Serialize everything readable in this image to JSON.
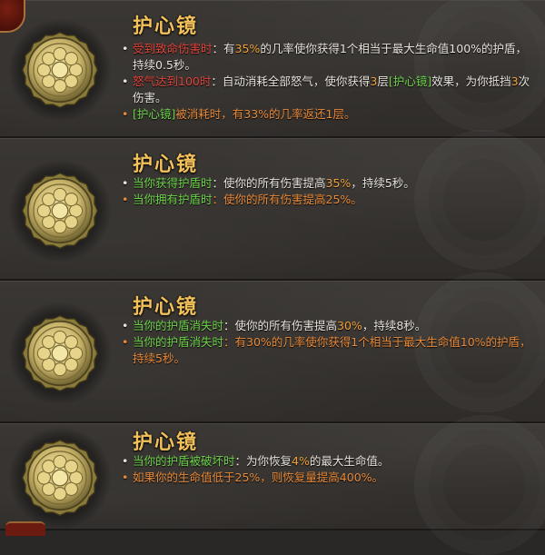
{
  "items": [
    {
      "title": "护心镜",
      "lines": [
        {
          "bullet_color": "w",
          "segments": [
            {
              "t": "受到致命伤害时",
              "c": "r"
            },
            {
              "t": "：有",
              "c": "w"
            },
            {
              "t": "35%",
              "c": "o"
            },
            {
              "t": "的几率使你获得1个相当于最大生命值100%的护盾，持续0.5秒。",
              "c": "w"
            }
          ]
        },
        {
          "bullet_color": "w",
          "segments": [
            {
              "t": "怒气达到100时",
              "c": "r"
            },
            {
              "t": "：自动消耗全部怒气，使你获得",
              "c": "w"
            },
            {
              "t": "3",
              "c": "o"
            },
            {
              "t": "层",
              "c": "w"
            },
            {
              "t": "[护心镜]",
              "c": "g"
            },
            {
              "t": "效果，为你抵挡",
              "c": "w"
            },
            {
              "t": "3",
              "c": "o"
            },
            {
              "t": "次伤害。",
              "c": "w"
            }
          ]
        },
        {
          "bullet_color": "cl",
          "segments": [
            {
              "t": "[护心镜]",
              "c": "g"
            },
            {
              "t": "被消耗时，有33%的几率返还1层。",
              "c": "cl"
            }
          ]
        }
      ]
    },
    {
      "title": "护心镜",
      "lines": [
        {
          "bullet_color": "w",
          "segments": [
            {
              "t": "当你获得护盾时",
              "c": "g"
            },
            {
              "t": "：使你的所有伤害提高",
              "c": "w"
            },
            {
              "t": "35%",
              "c": "o"
            },
            {
              "t": "，持续5秒。",
              "c": "w"
            }
          ]
        },
        {
          "bullet_color": "cl",
          "segments": [
            {
              "t": "当你拥有护盾时",
              "c": "g"
            },
            {
              "t": "：使你的所有伤害提高25%。",
              "c": "cl"
            }
          ]
        }
      ]
    },
    {
      "title": "护心镜",
      "lines": [
        {
          "bullet_color": "w",
          "segments": [
            {
              "t": "当你的护盾消失时",
              "c": "g"
            },
            {
              "t": "：使你的所有伤害提高",
              "c": "w"
            },
            {
              "t": "30%",
              "c": "o"
            },
            {
              "t": "，持续8秒。",
              "c": "w"
            }
          ]
        },
        {
          "bullet_color": "cl",
          "segments": [
            {
              "t": "当你的护盾消失时",
              "c": "g"
            },
            {
              "t": "：有30%的几率使你获得1个相当于最大生命值10%的护盾，持续5秒。",
              "c": "cl"
            }
          ]
        }
      ]
    },
    {
      "title": "护心镜",
      "lines": [
        {
          "bullet_color": "w",
          "segments": [
            {
              "t": "当你的护盾被破坏时",
              "c": "g"
            },
            {
              "t": "：为你恢复",
              "c": "w"
            },
            {
              "t": "4%",
              "c": "o"
            },
            {
              "t": "的最大生命值。",
              "c": "w"
            }
          ]
        },
        {
          "bullet_color": "cl",
          "segments": [
            {
              "t": "如果你的生命值低于25%，则恢复量提高400%。",
              "c": "cl"
            }
          ]
        }
      ]
    }
  ]
}
